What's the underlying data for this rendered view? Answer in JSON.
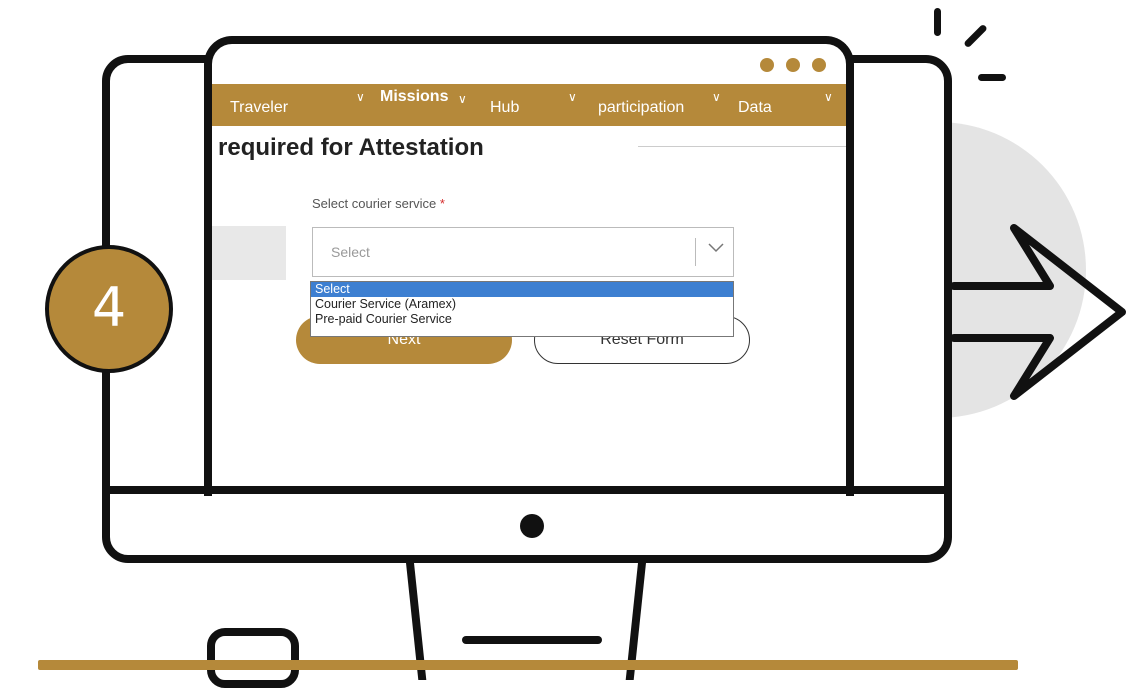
{
  "nav": {
    "items": [
      {
        "label": "Traveler"
      },
      {
        "label": "Missions"
      },
      {
        "label": "Hub"
      },
      {
        "label": "participation"
      },
      {
        "label": "Data"
      }
    ]
  },
  "page": {
    "heading": "required for Attestation",
    "field_label": "Select courier service",
    "required_mark": "*",
    "select_value": "Select"
  },
  "dropdown": {
    "options": [
      "Select",
      "Courier Service (Aramex)",
      "Pre-paid Courier Service"
    ],
    "selected_index": 0
  },
  "buttons": {
    "next": "Next",
    "reset": "Reset Form"
  },
  "step": {
    "number": "4"
  },
  "colors": {
    "accent": "#b5893a",
    "selected_option": "#3d7fd1"
  }
}
